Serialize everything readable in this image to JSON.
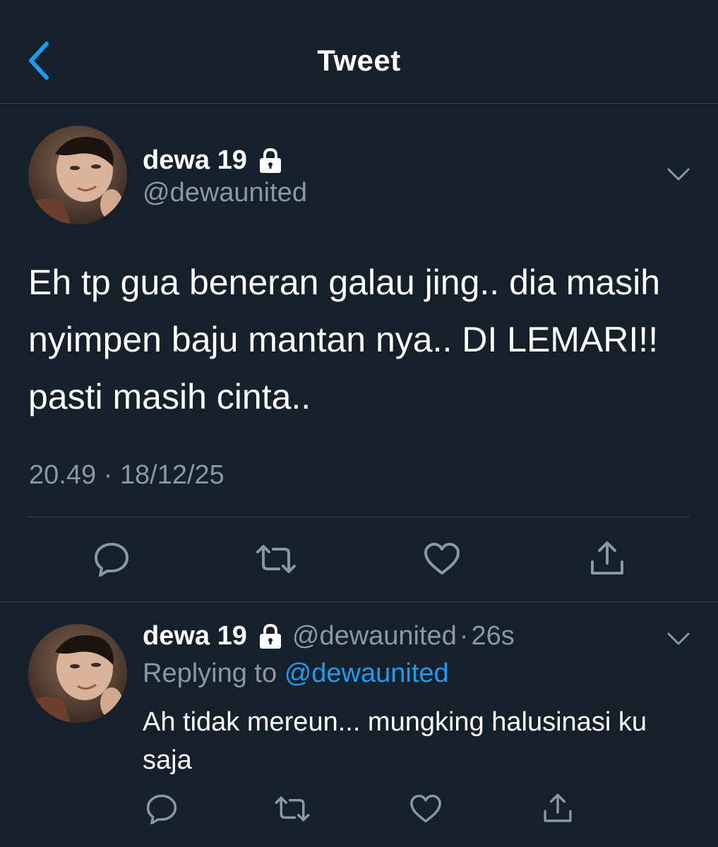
{
  "header": {
    "title": "Tweet",
    "back_icon": "chevron-left-icon"
  },
  "colors": {
    "background": "#15202b",
    "muted": "#8899a6",
    "accent": "#1d9bf0",
    "divider": "#38444d"
  },
  "tweet": {
    "display_name": "dewa 19",
    "handle": "@dewaunited",
    "text": "Eh tp gua beneran galau jing.. dia masih nyimpen baju mantan nya.. DI LEMARI!! pasti masih cinta..",
    "timestamp": "20.49 · 18/12/25",
    "actions": [
      "reply-icon",
      "retweet-icon",
      "like-icon",
      "share-icon"
    ]
  },
  "reply": {
    "display_name": "dewa 19",
    "handle": "@dewaunited",
    "separator": "·",
    "time": "26s",
    "replying_prefix": "Replying to",
    "replying_to": "@dewaunited",
    "text": "Ah tidak mereun... mungking halusinasi ku saja",
    "actions": [
      "reply-icon",
      "retweet-icon",
      "like-icon",
      "share-icon"
    ]
  }
}
